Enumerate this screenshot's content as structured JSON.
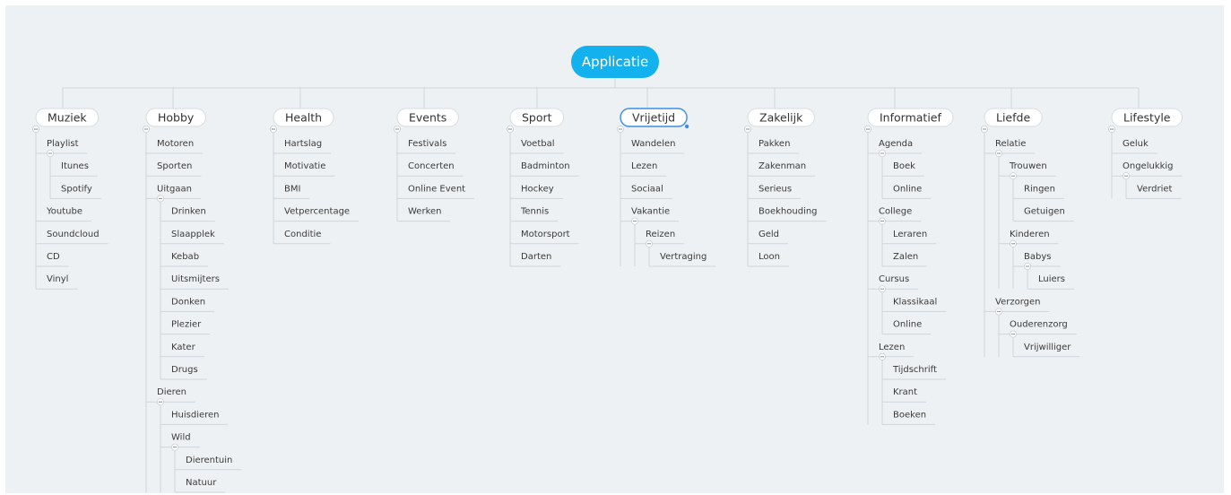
{
  "mindmap": {
    "root": "Applicatie",
    "selected": "Vrijetijd",
    "colors": {
      "accent": "#13b1ee",
      "selection": "#3a8ee6",
      "background": "#eef1f4"
    },
    "categories": [
      {
        "label": "Muziek",
        "children": [
          {
            "label": "Playlist",
            "children": [
              {
                "label": "Itunes"
              },
              {
                "label": "Spotify"
              }
            ]
          },
          {
            "label": "Youtube"
          },
          {
            "label": "Soundcloud"
          },
          {
            "label": "CD"
          },
          {
            "label": "Vinyl"
          }
        ]
      },
      {
        "label": "Hobby",
        "children": [
          {
            "label": "Motoren"
          },
          {
            "label": "Sporten"
          },
          {
            "label": "Uitgaan",
            "children": [
              {
                "label": "Drinken"
              },
              {
                "label": "Slaapplek"
              },
              {
                "label": "Kebab"
              },
              {
                "label": "Uitsmijters"
              },
              {
                "label": "Donken"
              },
              {
                "label": "Plezier"
              },
              {
                "label": "Kater"
              },
              {
                "label": "Drugs"
              }
            ]
          },
          {
            "label": "Dieren",
            "children": [
              {
                "label": "Huisdieren"
              },
              {
                "label": "Wild",
                "children": [
                  {
                    "label": "Dierentuin"
                  },
                  {
                    "label": "Natuur"
                  }
                ]
              }
            ]
          }
        ]
      },
      {
        "label": "Health",
        "children": [
          {
            "label": "Hartslag"
          },
          {
            "label": "Motivatie"
          },
          {
            "label": "BMI"
          },
          {
            "label": "Vetpercentage"
          },
          {
            "label": "Conditie"
          }
        ]
      },
      {
        "label": "Events",
        "children": [
          {
            "label": "Festivals"
          },
          {
            "label": "Concerten"
          },
          {
            "label": "Online Event"
          },
          {
            "label": "Werken"
          }
        ]
      },
      {
        "label": "Sport",
        "children": [
          {
            "label": "Voetbal"
          },
          {
            "label": "Badminton"
          },
          {
            "label": "Hockey"
          },
          {
            "label": "Tennis"
          },
          {
            "label": "Motorsport"
          },
          {
            "label": "Darten"
          }
        ]
      },
      {
        "label": "Vrijetijd",
        "children": [
          {
            "label": "Wandelen"
          },
          {
            "label": "Lezen"
          },
          {
            "label": "Sociaal"
          },
          {
            "label": "Vakantie",
            "children": [
              {
                "label": "Reizen",
                "children": [
                  {
                    "label": "Vertraging"
                  }
                ]
              }
            ]
          }
        ]
      },
      {
        "label": "Zakelijk",
        "children": [
          {
            "label": "Pakken"
          },
          {
            "label": "Zakenman"
          },
          {
            "label": "Serieus"
          },
          {
            "label": "Boekhouding"
          },
          {
            "label": "Geld"
          },
          {
            "label": "Loon"
          }
        ]
      },
      {
        "label": "Informatief",
        "children": [
          {
            "label": "Agenda",
            "children": [
              {
                "label": "Boek"
              },
              {
                "label": "Online"
              }
            ]
          },
          {
            "label": "College",
            "children": [
              {
                "label": "Leraren"
              },
              {
                "label": "Zalen"
              }
            ]
          },
          {
            "label": "Cursus",
            "children": [
              {
                "label": "Klassikaal"
              },
              {
                "label": "Online"
              }
            ]
          },
          {
            "label": "Lezen",
            "children": [
              {
                "label": "Tijdschrift"
              },
              {
                "label": "Krant"
              },
              {
                "label": "Boeken"
              }
            ]
          }
        ]
      },
      {
        "label": "Liefde",
        "children": [
          {
            "label": "Relatie",
            "children": [
              {
                "label": "Trouwen",
                "children": [
                  {
                    "label": "Ringen"
                  },
                  {
                    "label": "Getuigen"
                  }
                ]
              },
              {
                "label": "Kinderen",
                "children": [
                  {
                    "label": "Babys",
                    "children": [
                      {
                        "label": "Luiers"
                      }
                    ]
                  }
                ]
              }
            ]
          },
          {
            "label": "Verzorgen",
            "children": [
              {
                "label": "Ouderenzorg",
                "children": [
                  {
                    "label": "Vrijwilliger"
                  }
                ]
              }
            ]
          }
        ]
      },
      {
        "label": "Lifestyle",
        "children": [
          {
            "label": "Geluk"
          },
          {
            "label": "Ongelukkig",
            "children": [
              {
                "label": "Verdriet"
              }
            ]
          }
        ]
      }
    ]
  }
}
